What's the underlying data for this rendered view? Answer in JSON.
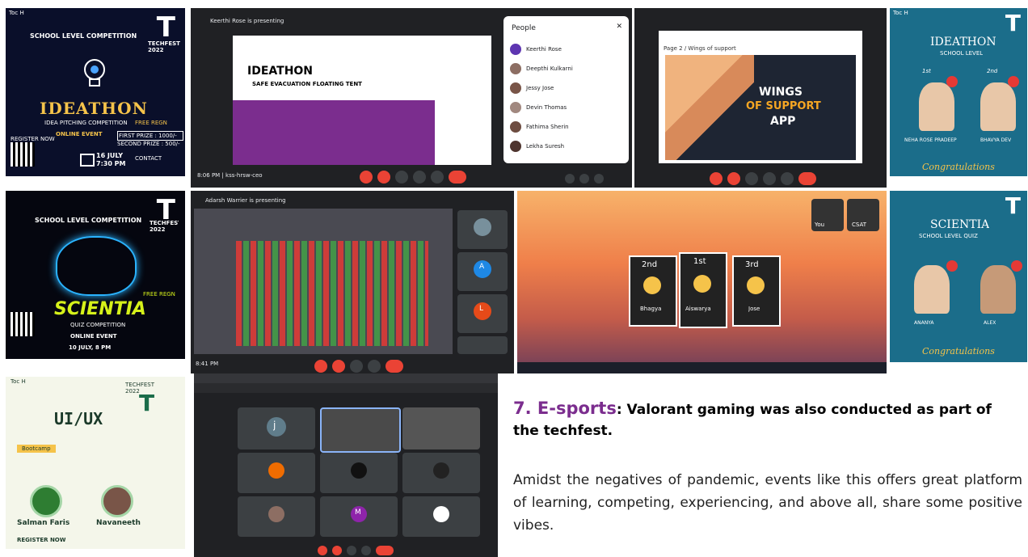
{
  "top_strip": "",
  "p1": {
    "org": "Toc H",
    "title": "SCHOOL LEVEL COMPETITION",
    "tf": "TECHFEST 2022",
    "event": "IDEATHON",
    "sub": "IDEA PITCHING COMPETITION",
    "mode": "ONLINE EVENT",
    "date": "16 JULY",
    "time": "7:30 PM",
    "free": "FREE REGN",
    "prize1": "FIRST PRIZE : 1000/-",
    "prize2": "SECOND PRIZE : 500/-",
    "contact": "CONTACT",
    "reg": "REGISTER NOW"
  },
  "m1": {
    "presenter": "Keerthi Rose is presenting",
    "slide_title": "IDEATHON",
    "slide_sub": "SAFE EVACUATION FLOATING TENT",
    "time": "8:06 PM | kss-hrsw-ceo",
    "people_title": "People",
    "people": [
      "Keerthi Rose",
      "Deepthi Kulkarni",
      "Jessy Jose",
      "Devin Thomas",
      "Fathima Sherin",
      "Lekha Suresh"
    ]
  },
  "m2": {
    "page": "Page 2 / Wings of support",
    "l1": "WINGS",
    "l2": "OF SUPPORT",
    "l3": "APP"
  },
  "p2": {
    "org": "Toc H",
    "event": "IDEATHON",
    "sub": "SCHOOL LEVEL",
    "first": "1st",
    "second": "2nd",
    "w1": "NEHA ROSE PRADEEP",
    "w2": "BHAVYA DEV",
    "congrats": "Congratulations"
  },
  "p3": {
    "title": "SCHOOL LEVEL COMPETITION",
    "tf": "TECHFEST 2022",
    "event": "SCIENTIA",
    "sub": "QUIZ COMPETITION",
    "mode": "ONLINE EVENT",
    "date": "10 JULY, 8 PM",
    "free": "FREE REGN"
  },
  "m3": {
    "title": "Adarsh Warrier is presenting",
    "tiles": [
      "A",
      "L"
    ],
    "time": "8:41 PM"
  },
  "m4": {
    "ranks": [
      "2nd",
      "1st",
      "3rd"
    ],
    "names": [
      "Bhagya",
      "Aiswarya",
      "Jose"
    ],
    "you": "You",
    "csat": "CSAT"
  },
  "p4": {
    "event": "SCIENTIA",
    "sub": "SCHOOL LEVEL QUIZ",
    "w1": "ANANYA",
    "w2": "ALEX",
    "congrats": "Congratulations"
  },
  "p5": {
    "org": "Toc H",
    "tf": "TECHFEST 2022",
    "title": "UI/UX",
    "bootcamp": "Bootcamp",
    "sp1": "Salman Faris",
    "sp2": "Navaneeth",
    "reg": "REGISTER NOW"
  },
  "m5": {
    "tile1": "j",
    "tile2": "M"
  },
  "section": {
    "number": "7. E-sports",
    "heading_rest": ": Valorant gaming was also conducted as part of the techfest.",
    "para": "Amidst the negatives of pandemic, events like this offers great platform of learning, competing, experiencing, and above all, share some positive vibes."
  },
  "colors": {
    "accent": "#7b2d8e",
    "meet_bg": "#202124",
    "end_call": "#ea4335"
  }
}
